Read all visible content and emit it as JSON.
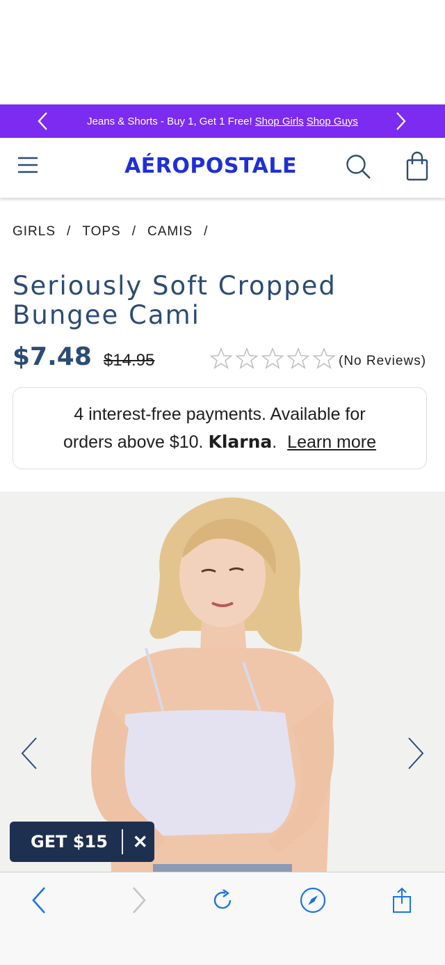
{
  "promo": {
    "text": "Jeans & Shorts - Buy 1, Get 1 Free!",
    "link_girls": "Shop Girls",
    "link_guys": "Shop Guys",
    "background": "#7c2bf0"
  },
  "header": {
    "logo": "AÉROPOSTALE",
    "brand_color": "#1f2fd6",
    "icons": [
      "menu-icon",
      "search-icon",
      "shopping-bag-icon"
    ]
  },
  "breadcrumb": {
    "items": [
      "GIRLS",
      "TOPS",
      "CAMIS"
    ],
    "separator": "/"
  },
  "product": {
    "title": "Seriously Soft Cropped Bungee Cami",
    "sale_price": "$7.48",
    "original_price": "$14.95",
    "rating": 0,
    "reviews": "(No Reviews)"
  },
  "klarna": {
    "line1": "4 interest-free payments. Available for",
    "line2_prefix": "orders above $10.",
    "brand": "Klarna",
    "period": ".",
    "learn_more": "Learn more"
  },
  "gallery": {
    "prev_icon": "chevron-left-icon",
    "next_icon": "chevron-right-icon"
  },
  "offer": {
    "label": "GET $15",
    "close": "✕"
  },
  "browser": {
    "icons": [
      "back-icon",
      "forward-icon",
      "reload-icon",
      "compass-icon",
      "share-icon"
    ],
    "accent": "#1a73e8"
  }
}
